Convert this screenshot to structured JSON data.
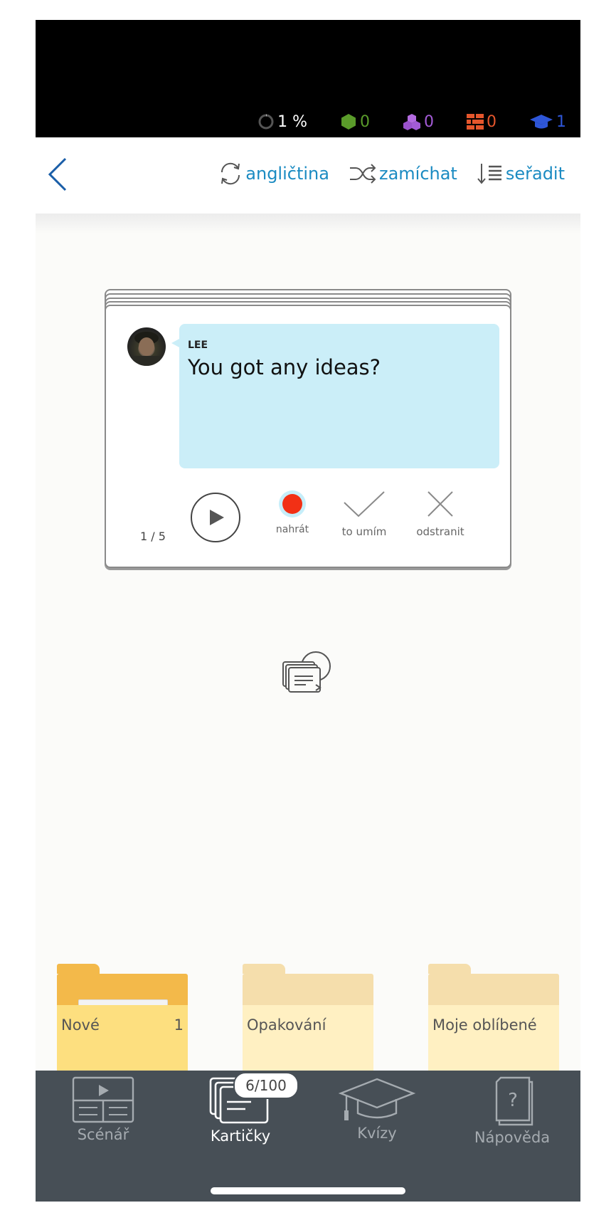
{
  "status": {
    "progress": "1 %",
    "green": "0",
    "purple": "0",
    "orange": "0",
    "blue": "1",
    "colors": {
      "green": "#5a9b2a",
      "purple": "#a35bd6",
      "orange": "#e5562c",
      "blue": "#2e56d8"
    },
    "icons": [
      "progress-ring-icon",
      "hexagon-icon",
      "cubes-icon",
      "bricks-icon",
      "graduation-cap-icon"
    ]
  },
  "nav": {
    "language": "angličtina",
    "shuffle": "zamíchat",
    "sort": "seřadit",
    "accent": "#1b8bc2"
  },
  "card": {
    "speaker": "LEE",
    "text": "You got any ideas?",
    "counter": "1 / 5",
    "record": "nahrát",
    "know": "to umím",
    "remove": "odstranit"
  },
  "folders": [
    {
      "label": "Nové",
      "count": "1"
    },
    {
      "label": "Opakování",
      "count": ""
    },
    {
      "label": "Moje oblíbené",
      "count": ""
    }
  ],
  "tabbar": {
    "badge": "6/100",
    "tabs": [
      {
        "label": "Scénář"
      },
      {
        "label": "Kartičky"
      },
      {
        "label": "Kvízy"
      },
      {
        "label": "Nápověda"
      }
    ]
  }
}
